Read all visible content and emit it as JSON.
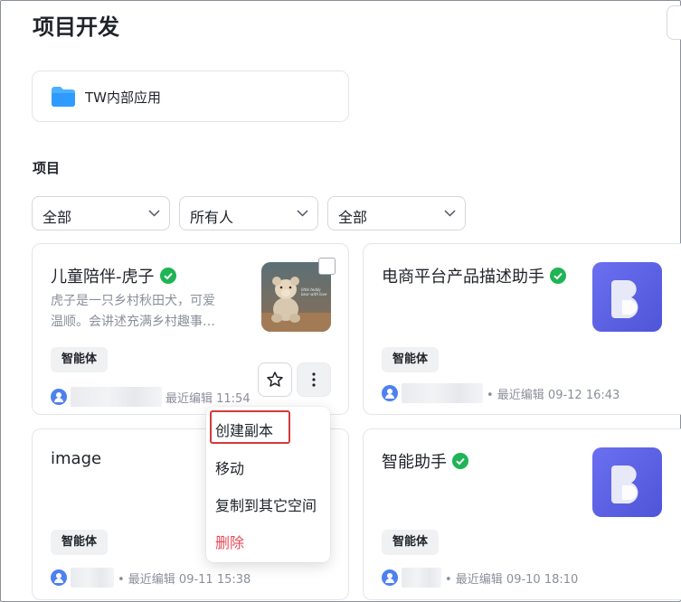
{
  "page": {
    "title": "项目开发"
  },
  "folder": {
    "label": "TW内部应用",
    "icon": "folder-icon",
    "color": "#3aa0ff"
  },
  "section": {
    "title": "项目"
  },
  "filters": [
    {
      "value": "全部"
    },
    {
      "value": "所有人"
    },
    {
      "value": "全部"
    }
  ],
  "cards": [
    {
      "title": "儿童陪伴-虎子",
      "verified": true,
      "description_lines": [
        "虎子是一只乡村秋田犬，可爱",
        "温顺。会讲述充满乡村趣事…"
      ],
      "tag": "智能体",
      "meta": "最近编辑 11:54",
      "thumb_text": "little teddy bear with love"
    },
    {
      "title": "电商平台产品描述助手",
      "verified": true,
      "tag": "智能体",
      "meta": "• 最近编辑 09-12 16:43"
    },
    {
      "title": "image",
      "verified": false,
      "tag": "智能体",
      "meta": "• 最近编辑 09-11 15:38"
    },
    {
      "title": "智能助手",
      "verified": true,
      "tag": "智能体",
      "meta": "• 最近编辑 09-10 18:10"
    }
  ],
  "context_menu": {
    "items": [
      {
        "label": "创建副本"
      },
      {
        "label": "移动"
      },
      {
        "label": "复制到其它空间"
      },
      {
        "label": "删除",
        "danger": true
      }
    ]
  },
  "colors": {
    "verified": "#1fb455",
    "brand_gradient_start": "#6b6ff0",
    "brand_gradient_end": "#4f55d8",
    "danger": "#e34d59",
    "highlight": "#d23a3a",
    "avatar": "#4e80f0"
  }
}
